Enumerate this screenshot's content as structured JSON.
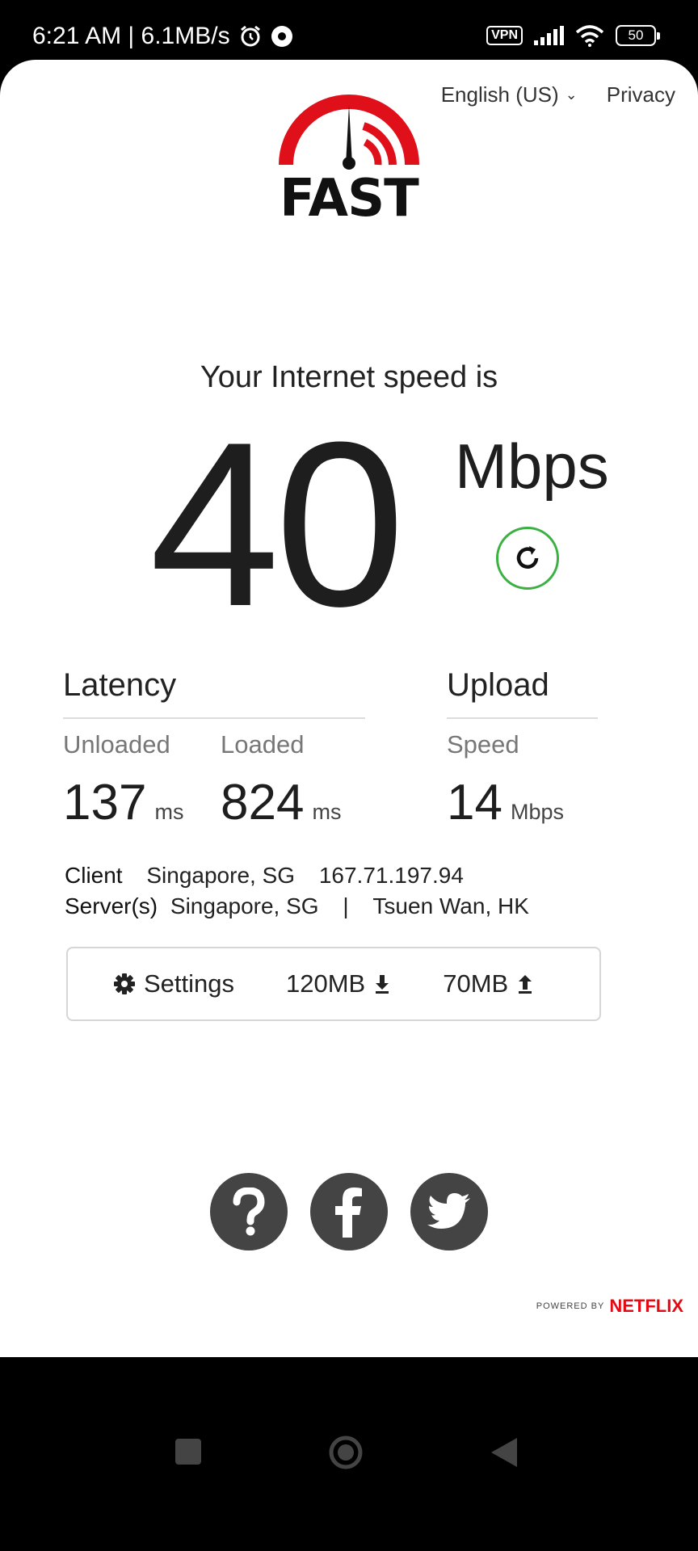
{
  "status_bar": {
    "time_speed": "6:21 AM | 6.1MB/s",
    "vpn": "VPN",
    "battery": "50"
  },
  "header": {
    "language": "English (US)",
    "privacy": "Privacy",
    "logo_text": "FAST"
  },
  "speed": {
    "intro": "Your Internet speed is",
    "value": "40",
    "unit": "Mbps"
  },
  "latency": {
    "title": "Latency",
    "unloaded_label": "Unloaded",
    "unloaded_value": "137",
    "loaded_label": "Loaded",
    "loaded_value": "824",
    "unit": "ms"
  },
  "upload": {
    "title": "Upload",
    "speed_label": "Speed",
    "speed_value": "14",
    "unit": "Mbps"
  },
  "client": {
    "label": "Client",
    "location": "Singapore, SG",
    "ip": "167.71.197.94"
  },
  "servers": {
    "label": "Server(s)",
    "location1": "Singapore, SG",
    "separator": "|",
    "location2": "Tsuen Wan, HK"
  },
  "settings": {
    "label": "Settings",
    "download_size": "120MB",
    "upload_size": "70MB"
  },
  "footer": {
    "powered_by": "POWERED BY",
    "brand": "NETFLIX"
  },
  "colors": {
    "accent_green": "#3cb043",
    "logo_red": "#e0101a",
    "netflix_red": "#e50914"
  }
}
